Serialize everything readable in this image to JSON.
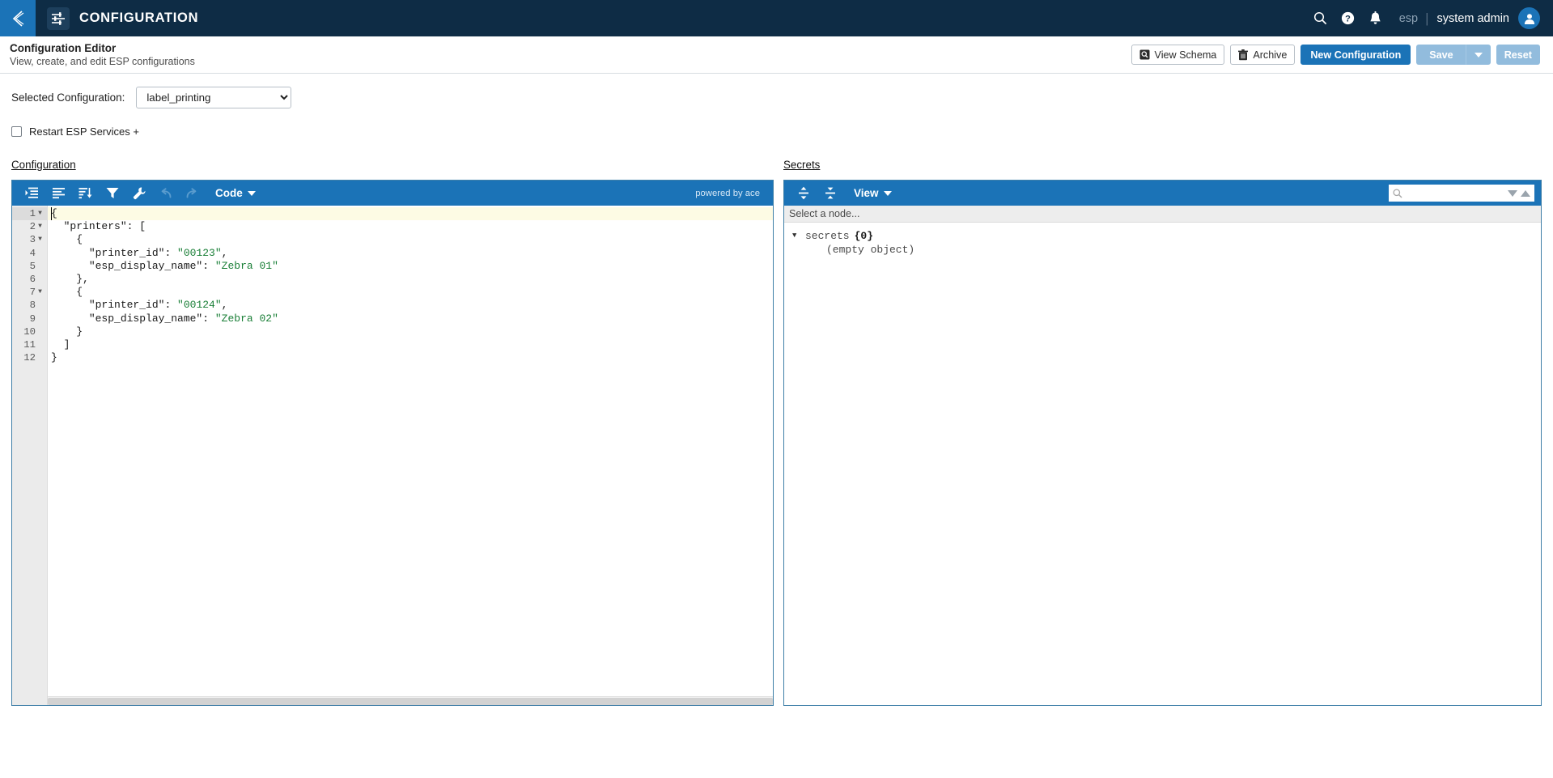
{
  "topbar": {
    "back_icon": "chevron-left-icon",
    "app_icon": "sliders-settings-icon",
    "title": "CONFIGURATION",
    "search_icon": "search-icon",
    "help_icon": "help-circle-icon",
    "notifications_icon": "bell-icon",
    "tenant": "esp",
    "divider": "|",
    "user": "system admin",
    "avatar_icon": "user-avatar-icon",
    "bg_color": "#0e2c45",
    "accent_color": "#1b73b7"
  },
  "page_header": {
    "title": "Configuration Editor",
    "subtitle": "View, create, and edit ESP configurations",
    "actions": {
      "view_schema": "View Schema",
      "view_schema_icon": "magnifier-square-icon",
      "archive": "Archive",
      "archive_icon": "trash-icon",
      "new_configuration": "New Configuration",
      "save": "Save",
      "save_caret_icon": "caret-down-icon",
      "reset": "Reset"
    }
  },
  "selection": {
    "label": "Selected Configuration:",
    "value": "label_printing",
    "options": [
      "label_printing"
    ]
  },
  "restart": {
    "label": "Restart ESP Services +",
    "checked": false
  },
  "configuration_panel": {
    "title": "Configuration",
    "toolbar": {
      "format_icon": "format-indent-icon",
      "compact_icon": "compact-lines-icon",
      "sort_icon": "sort-descending-icon",
      "filter_icon": "filter-funnel-icon",
      "repair_icon": "wrench-icon",
      "undo_icon": "undo-arrow-icon",
      "redo_icon": "redo-arrow-icon",
      "mode_label": "Code",
      "mode_caret_icon": "caret-down-icon",
      "credit": "powered by ace"
    },
    "lines": [
      {
        "n": "1",
        "fold": true,
        "active": true,
        "text": "{"
      },
      {
        "n": "2",
        "fold": true,
        "active": false,
        "text": "  \"printers\": ["
      },
      {
        "n": "3",
        "fold": true,
        "active": false,
        "text": "    {"
      },
      {
        "n": "4",
        "fold": false,
        "active": false,
        "text": "      \"printer_id\": \"00123\","
      },
      {
        "n": "5",
        "fold": false,
        "active": false,
        "text": "      \"esp_display_name\": \"Zebra 01\""
      },
      {
        "n": "6",
        "fold": false,
        "active": false,
        "text": "    },"
      },
      {
        "n": "7",
        "fold": true,
        "active": false,
        "text": "    {"
      },
      {
        "n": "8",
        "fold": false,
        "active": false,
        "text": "      \"printer_id\": \"00124\","
      },
      {
        "n": "9",
        "fold": false,
        "active": false,
        "text": "      \"esp_display_name\": \"Zebra 02\""
      },
      {
        "n": "10",
        "fold": false,
        "active": false,
        "text": "    }"
      },
      {
        "n": "11",
        "fold": false,
        "active": false,
        "text": "  ]"
      },
      {
        "n": "12",
        "fold": false,
        "active": false,
        "text": "}"
      }
    ],
    "string_color": "#1a7f37"
  },
  "secrets_panel": {
    "title": "Secrets",
    "toolbar": {
      "expand_all_icon": "expand-all-icon",
      "collapse_all_icon": "collapse-all-icon",
      "view_label": "View",
      "view_caret_icon": "caret-down-icon",
      "search_icon": "search-icon",
      "search_value": "",
      "search_placeholder": "",
      "next_match_icon": "triangle-down-icon",
      "prev_match_icon": "triangle-up-icon"
    },
    "node_bar": "Select a node...",
    "tree": {
      "toggle_icon": "triangle-down-icon",
      "root_label": "secrets",
      "root_count": "{0}",
      "empty_text": "(empty object)"
    }
  }
}
